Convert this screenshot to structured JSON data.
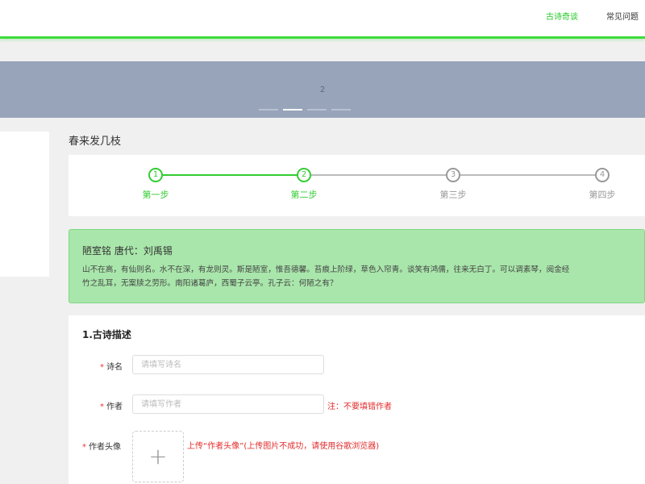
{
  "header": {
    "nav": [
      {
        "label": "古诗奇谈",
        "active": true
      },
      {
        "label": "常见问题",
        "active": false
      }
    ]
  },
  "banner": {
    "slide_number": "2",
    "dot_count": 4,
    "active_dot": 1
  },
  "page": {
    "section_title": "春来发几枝"
  },
  "steps": [
    {
      "number": "1",
      "label": "第一步",
      "done": true
    },
    {
      "number": "2",
      "label": "第二步",
      "done": true
    },
    {
      "number": "3",
      "label": "第三步",
      "done": false
    },
    {
      "number": "4",
      "label": "第四步",
      "done": false
    }
  ],
  "poem": {
    "title": "陋室铭 唐代：刘禹锡",
    "line1": "山不在高，有仙则名。水不在深，有龙则灵。斯是陋室，惟吾德馨。苔痕上阶绿，草色入帘青。谈笑有鸿儒，往来无白丁。可以调素琴，阅金经",
    "line2": "竹之乱耳，无案牍之劳形。南阳诸葛庐，西蜀子云亭。孔子云：何陋之有？"
  },
  "form": {
    "section_title": "1.古诗描述",
    "fields": {
      "poem_name": {
        "label": "诗名",
        "placeholder": "请填写诗名",
        "value": ""
      },
      "author": {
        "label": "作者",
        "placeholder": "请填写作者",
        "value": "",
        "hint": "注：不要填错作者"
      },
      "avatar": {
        "label": "作者头像",
        "hint": "上传“作者头像”(上传图片不成功，请使用谷歌浏览器)",
        "plus": "+"
      }
    },
    "required_mark": "*"
  },
  "colors": {
    "accent_green": "#33cc33",
    "banner_bg": "#97a4ba",
    "poem_box_bg": "#a9e6ab",
    "hint_red": "#e32b2b"
  }
}
